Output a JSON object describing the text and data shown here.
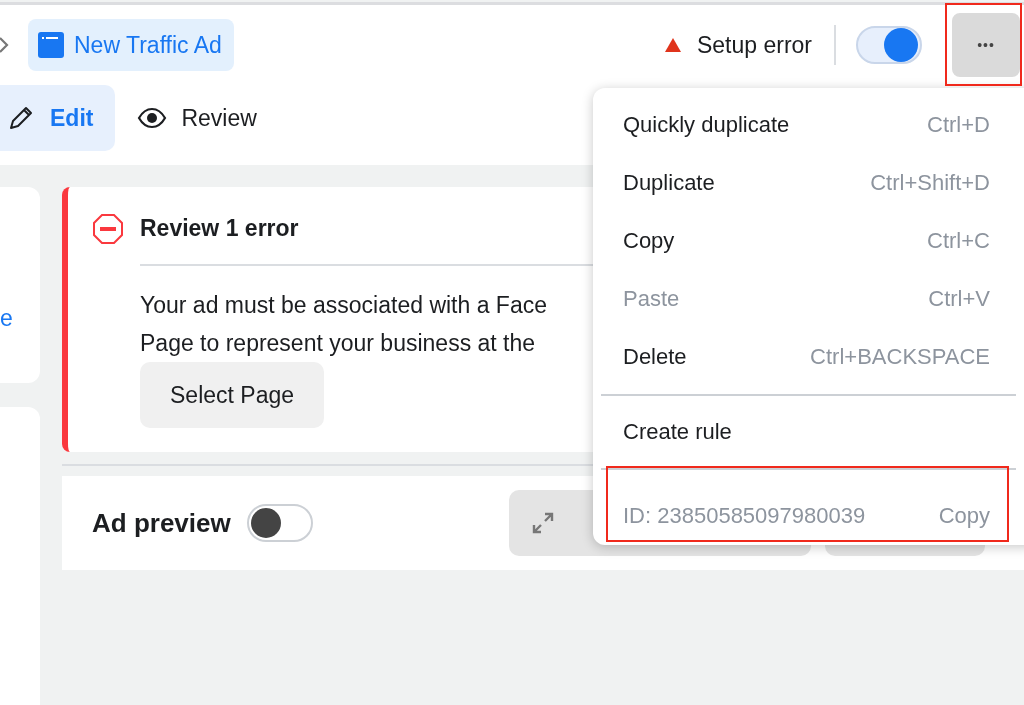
{
  "header": {
    "title": "New Traffic Ad",
    "status": "Setup error",
    "toggle": {
      "on": true
    },
    "more_button": {
      "label": "•••",
      "highlighted": true
    }
  },
  "tabs": [
    {
      "label": "Edit",
      "selected": true,
      "kind": "edit"
    },
    {
      "label": "Review",
      "selected": false,
      "kind": "review"
    }
  ],
  "side_card": {
    "link": "e"
  },
  "error_card": {
    "title": "Review 1 error",
    "lines": [
      "Your ad must be associated with a Face",
      "Page to represent your business at the"
    ],
    "button": "Select Page"
  },
  "ad_preview": {
    "title": "Ad preview",
    "toggle": {
      "on": false
    }
  },
  "menu": {
    "items": [
      {
        "label": "Quickly duplicate",
        "shortcut": "Ctrl+D",
        "disabled": false
      },
      {
        "label": "Duplicate",
        "shortcut": "Ctrl+Shift+D",
        "disabled": false
      },
      {
        "label": "Copy",
        "shortcut": "Ctrl+C",
        "disabled": false
      },
      {
        "label": "Paste",
        "shortcut": "Ctrl+V",
        "disabled": true
      },
      {
        "label": "Delete",
        "shortcut": "Ctrl+BACKSPACE",
        "disabled": false
      },
      {
        "label": "Create rule",
        "disabled": false
      }
    ],
    "id_row": {
      "id": "ID: 23850585097980039",
      "action": "Copy",
      "highlighted": true
    }
  }
}
